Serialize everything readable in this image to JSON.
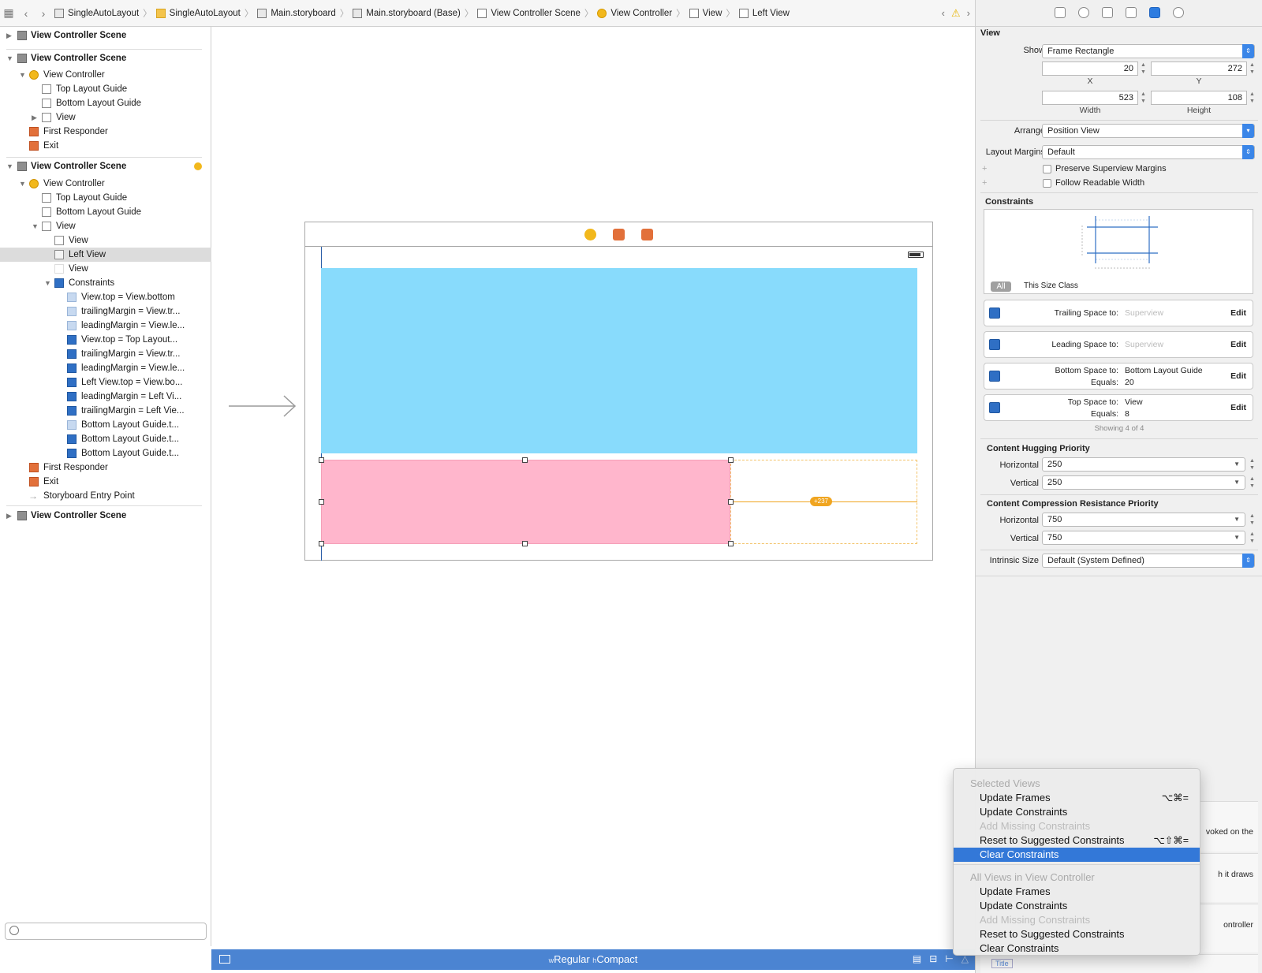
{
  "toolbar": {
    "breadcrumbs": [
      "SingleAutoLayout",
      "SingleAutoLayout",
      "Main.storyboard",
      "Main.storyboard (Base)",
      "View Controller Scene",
      "View Controller",
      "View",
      "Left View"
    ]
  },
  "outline": {
    "rows": [
      {
        "label": "View Controller Scene",
        "bold": true
      },
      {
        "label": "View Controller Scene",
        "bold": true
      },
      {
        "label": "View Controller"
      },
      {
        "label": "Top Layout Guide"
      },
      {
        "label": "Bottom Layout Guide"
      },
      {
        "label": "View"
      },
      {
        "label": "First Responder"
      },
      {
        "label": "Exit"
      },
      {
        "label": "View Controller Scene",
        "bold": true
      },
      {
        "label": "View Controller"
      },
      {
        "label": "Top Layout Guide"
      },
      {
        "label": "Bottom Layout Guide"
      },
      {
        "label": "View"
      },
      {
        "label": "View"
      },
      {
        "label": "Left View"
      },
      {
        "label": "View"
      },
      {
        "label": "Constraints"
      },
      {
        "label": "View.top = View.bottom"
      },
      {
        "label": "trailingMargin = View.tr..."
      },
      {
        "label": "leadingMargin = View.le..."
      },
      {
        "label": "View.top = Top Layout..."
      },
      {
        "label": "trailingMargin = View.tr..."
      },
      {
        "label": "leadingMargin = View.le..."
      },
      {
        "label": "Left View.top = View.bo..."
      },
      {
        "label": "leadingMargin = Left Vi..."
      },
      {
        "label": "trailingMargin = Left Vie..."
      },
      {
        "label": "Bottom Layout Guide.t..."
      },
      {
        "label": "Bottom Layout Guide.t..."
      },
      {
        "label": "Bottom Layout Guide.t..."
      },
      {
        "label": "First Responder"
      },
      {
        "label": "Exit"
      },
      {
        "label": "Storyboard Entry Point"
      },
      {
        "label": "View Controller Scene",
        "bold": true
      }
    ]
  },
  "canvas": {
    "constraint_badge": "+237",
    "size_class_w_prefix": "w",
    "size_class_w": "Regular",
    "size_class_h_prefix": "h",
    "size_class_h": "Compact"
  },
  "inspector": {
    "section_title": "View",
    "show_label": "Show",
    "show_value": "Frame Rectangle",
    "x_value": "20",
    "y_value": "272",
    "x_label": "X",
    "y_label": "Y",
    "width_value": "523",
    "height_value": "108",
    "width_label": "Width",
    "height_label": "Height",
    "arrange_label": "Arrange",
    "arrange_value": "Position View",
    "layout_margins_label": "Layout Margins",
    "layout_margins_value": "Default",
    "preserve_label": "Preserve Superview Margins",
    "readable_label": "Follow Readable Width",
    "constraints_title": "Constraints",
    "all_label": "All",
    "size_class_label": "This Size Class",
    "constraints": [
      {
        "l1": "Trailing Space to:",
        "v1": "Superview",
        "l2": "",
        "v2": "",
        "edit": "Edit",
        "dim": true
      },
      {
        "l1": "Leading Space to:",
        "v1": "Superview",
        "l2": "",
        "v2": "",
        "edit": "Edit",
        "dim": true
      },
      {
        "l1": "Bottom Space to:",
        "v1": "Bottom Layout Guide",
        "l2": "Equals:",
        "v2": "20",
        "edit": "Edit",
        "dim": false
      },
      {
        "l1": "Top Space to:",
        "v1": "View",
        "l2": "Equals:",
        "v2": "8",
        "edit": "Edit",
        "dim": false
      }
    ],
    "showing": "Showing 4 of 4",
    "hugging_title": "Content Hugging Priority",
    "horizontal_label": "Horizontal",
    "vertical_label": "Vertical",
    "hug_h": "250",
    "hug_v": "250",
    "compression_title": "Content Compression Resistance Priority",
    "comp_h": "750",
    "comp_v": "750",
    "intrinsic_label": "Intrinsic Size",
    "intrinsic_value": "Default (System Defined)",
    "peek1": "voked on the",
    "peek2": "h it draws",
    "peek3": "ontroller",
    "peek4": "Title"
  },
  "menu": {
    "items": [
      {
        "label": "Selected Views",
        "type": "hdr",
        "shortcut": ""
      },
      {
        "label": "Update Frames",
        "type": "item",
        "shortcut": "⌥⌘="
      },
      {
        "label": "Update Constraints",
        "type": "item",
        "shortcut": ""
      },
      {
        "label": "Add Missing Constraints",
        "type": "dis",
        "shortcut": ""
      },
      {
        "label": "Reset to Suggested Constraints",
        "type": "item",
        "shortcut": "⌥⇧⌘="
      },
      {
        "label": "Clear Constraints",
        "type": "hl",
        "shortcut": ""
      },
      {
        "label": "All Views in View Controller",
        "type": "hdr",
        "shortcut": ""
      },
      {
        "label": "Update Frames",
        "type": "item",
        "shortcut": ""
      },
      {
        "label": "Update Constraints",
        "type": "item",
        "shortcut": ""
      },
      {
        "label": "Add Missing Constraints",
        "type": "dis",
        "shortcut": ""
      },
      {
        "label": "Reset to Suggested Constraints",
        "type": "item",
        "shortcut": ""
      },
      {
        "label": "Clear Constraints",
        "type": "item",
        "shortcut": ""
      }
    ]
  },
  "colors": {
    "accent": "#3378d8",
    "blue_view": "#88dbfc",
    "pink_view": "#ffb6cc",
    "constraint_orange": "#f0a520",
    "bottom_bar": "#4b84d2"
  }
}
